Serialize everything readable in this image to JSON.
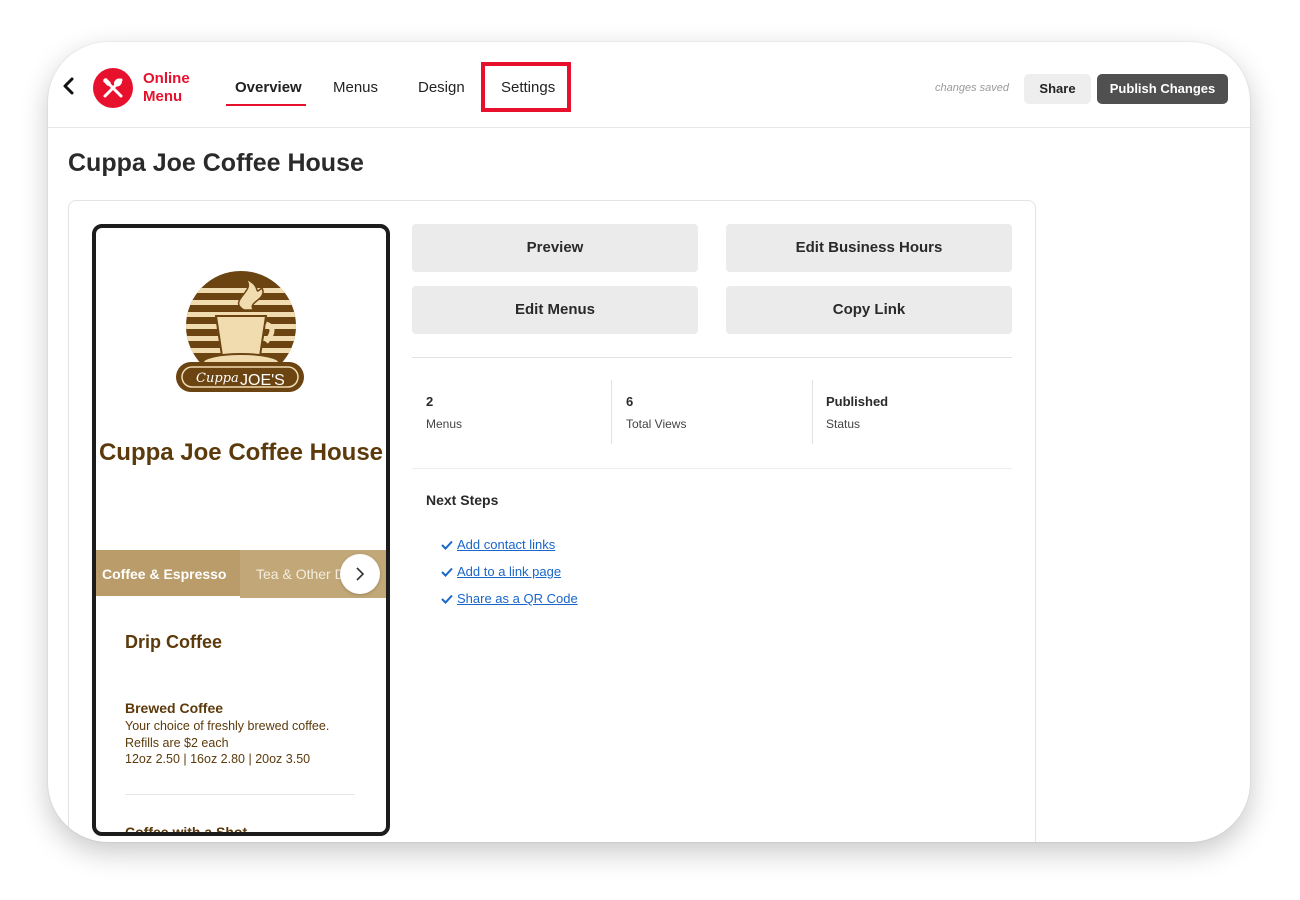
{
  "app": {
    "name": "Online Menu"
  },
  "nav": {
    "tabs": [
      {
        "label": "Overview",
        "active": true
      },
      {
        "label": "Menus"
      },
      {
        "label": "Design"
      },
      {
        "label": "Settings",
        "highlighted": true
      }
    ]
  },
  "header": {
    "status": "changes saved",
    "share_label": "Share",
    "publish_label": "Publish Changes"
  },
  "page": {
    "title": "Cuppa Joe Coffee House"
  },
  "preview": {
    "logo_words": [
      "Cuppa",
      "JOE'S"
    ],
    "business_name": "Cuppa Joe Coffee House",
    "tabs": [
      "Coffee & Espresso",
      "Tea & Other D"
    ],
    "section": "Drip Coffee",
    "items": [
      {
        "name": "Brewed Coffee",
        "description": "Your choice of freshly brewed coffee. Refills are $2 each",
        "prices": "12oz 2.50 | 16oz 2.80 | 20oz 3.50"
      },
      {
        "name": "Coffee with a Shot"
      }
    ]
  },
  "actions": {
    "preview": "Preview",
    "edit_hours": "Edit Business Hours",
    "edit_menus": "Edit Menus",
    "copy_link": "Copy Link"
  },
  "stats": [
    {
      "value": "2",
      "label": "Menus"
    },
    {
      "value": "6",
      "label": "Total Views"
    },
    {
      "value": "Published",
      "label": "Status"
    }
  ],
  "next_steps": {
    "title": "Next Steps",
    "items": [
      "Add contact links",
      "Add to a link page",
      "Share as a QR Code"
    ]
  },
  "colors": {
    "brand_red": "#e8112d",
    "coffee_brown": "#5c3a0b",
    "tab_tan": "#c2a878",
    "link_blue": "#1a66c9",
    "publish_dark": "#505050"
  },
  "icons": [
    "back-chevron-icon",
    "fork-knife-icon",
    "chevron-right-icon",
    "checkmark-icon"
  ]
}
